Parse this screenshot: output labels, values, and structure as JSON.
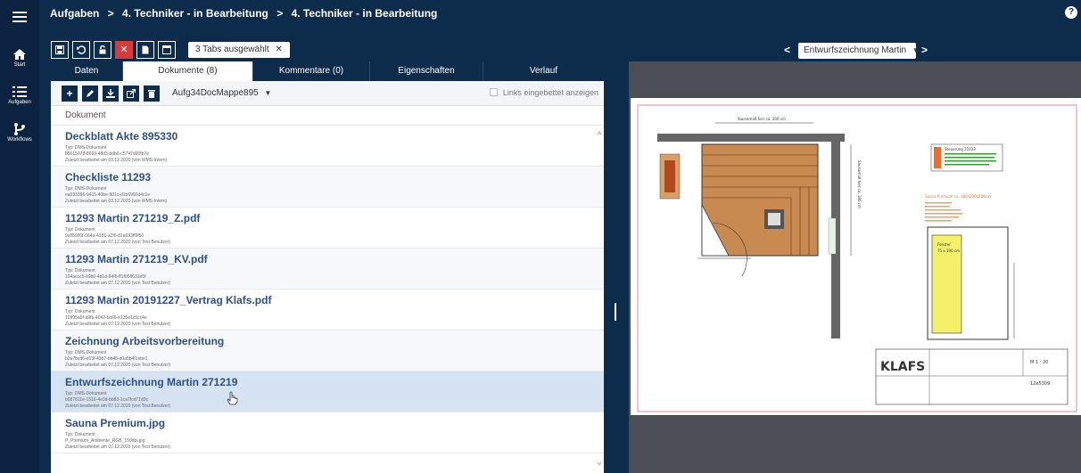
{
  "nav": {
    "items": [
      {
        "icon": "menu-icon",
        "label": ""
      },
      {
        "icon": "home-icon",
        "label": "Start"
      },
      {
        "icon": "tasks-icon",
        "label": "Aufgaben"
      },
      {
        "icon": "workflow-icon",
        "label": "Workflows"
      }
    ]
  },
  "breadcrumb": {
    "root": "Aufgaben",
    "sep": ">",
    "level1": "4. Techniker - in Bearbeitung",
    "level2": "4. Techniker - in Bearbeitung"
  },
  "help_label": "?",
  "toolbar": {
    "chip_label": "3 Tabs ausgewählt",
    "chip_close": "✕"
  },
  "tabs": [
    {
      "label": "Daten",
      "active": false
    },
    {
      "label": "Dokumente (8)",
      "active": true
    },
    {
      "label": "Kommentare (0)",
      "active": false
    },
    {
      "label": "Eigenschaften",
      "active": false
    },
    {
      "label": "Verlauf",
      "active": false
    }
  ],
  "panel": {
    "mappe": "Aufg34DocMappe895",
    "mappe_caret": "▼",
    "links_label": "Links eingebettet anzeigen",
    "column_header": "Dokument"
  },
  "documents": [
    {
      "title": "Deckblatt Akte 895330",
      "type": "Typ: DMS-Dokument",
      "id": "85515078-8693-48d3-bdb6-c5747d90fb7e",
      "edited": "Zuletzt bearbeitet am 03.12.2020 (von WMS-Intern)"
    },
    {
      "title": "Checkliste 11293",
      "type": "Typ: DMS-Dokument",
      "id": "ea033396-9415-40be-901c-d1b6992d4c1e",
      "edited": "Zuletzt bearbeitet am 03.12.2020 (von WMS-Intern)"
    },
    {
      "title": "11293 Martin 271219_Z.pdf",
      "type": "Typ: Dokument",
      "id": "9c85900f-564a-4181-a2f6-81a693ff9f50",
      "edited": "Zuletzt bearbeitet am 07.12.2020 (von Test Benutzer)"
    },
    {
      "title": "11293 Martin 271219_KV.pdf",
      "type": "Typ: Dokument",
      "id": "104accc5-b9b0-4b1d-84f6-ff1f008633e5f",
      "edited": "Zuletzt bearbeitet am 07.12.2020 (von Test Benutzer)"
    },
    {
      "title": "11293 Martin 20191227_Vertrag Klafs.pdf",
      "type": "Typ: Dokument",
      "id": "10995a5f-a9fe-4042-bc66-e135e1c5cc4e",
      "edited": "Zuletzt bearbeitet am 07.12.2020 (von Test Benutzer)"
    },
    {
      "title": "Zeichnung Arbeitsvorbereitung",
      "type": "Typ: DMS-Dokument",
      "id": "b2a7bcd6-e53f-43b7-bb48-d0a5b4f1ebe1",
      "edited": "Zuletzt bearbeitet am 07.12.2020 (von Test Benutzer)"
    },
    {
      "title": "Entwurfszeichnung Martin 271219",
      "type": "Typ: DMS-Dokument",
      "id": "b087811e-1516-4e3d-bb83-1ca7fcd71d3c",
      "edited": "Zuletzt bearbeitet am 07.12.2020 (von Test Benutzer)"
    },
    {
      "title": "Sauna Premium.jpg",
      "type": "Typ: Dokument",
      "id": "P_Premium_Ambiente_RGB_150dpi.jpg",
      "edited": "Zuletzt bearbeitet am 07.12.2020 (von Test Benutzer)"
    }
  ],
  "viewer": {
    "selected": "Entwurfszeichnung Martin",
    "caret": "▼",
    "prev": "<",
    "next": ">",
    "brand": "KLAFS",
    "scale": "M 1 : 20",
    "drawing_no": "12e5309",
    "dim_top": "Saunamaß hier ca. 200 cm",
    "dim_side": "Saunamaß hier ca. 180 cm",
    "spec_box": "Steuerung 21033",
    "sauna_note": "Sauna Premium ca. 180x200x208cm",
    "window_label": "Fenster",
    "window_size": "75 x 190 cm"
  },
  "colors": {
    "nav_bg": "#0b2340",
    "accent": "#0d2b4a",
    "title_blue": "#2e4f86",
    "highlight": "#d6e3f3",
    "delete_red": "#d93b3b"
  }
}
